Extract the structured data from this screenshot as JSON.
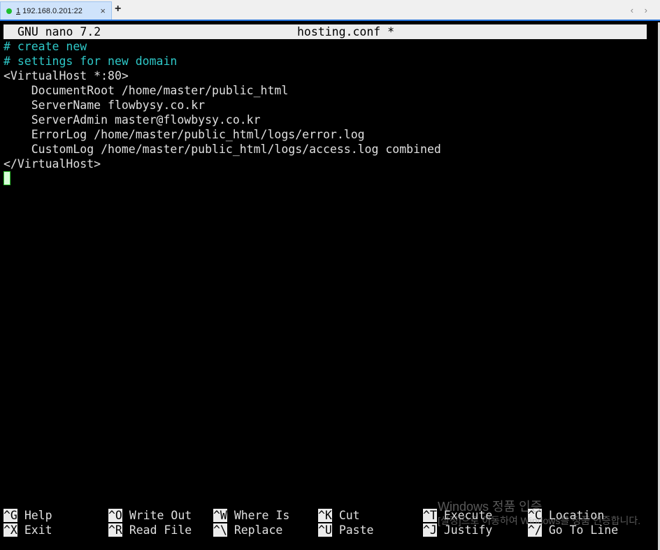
{
  "tab": {
    "number": "1",
    "host": " 192.168.0.201:22",
    "close": "×",
    "new": "+"
  },
  "nav": {
    "arrows": "‹ ›"
  },
  "editor": {
    "app": "GNU nano 7.2",
    "filename": "hosting.conf *",
    "lines": [
      {
        "text": "# create new",
        "comment": true
      },
      {
        "text": "# settings for new domain",
        "comment": true
      },
      {
        "text": "<VirtualHost *:80>",
        "comment": false
      },
      {
        "text": "    DocumentRoot /home/master/public_html",
        "comment": false
      },
      {
        "text": "    ServerName flowbysy.co.kr",
        "comment": false
      },
      {
        "text": "    ServerAdmin master@flowbysy.co.kr",
        "comment": false
      },
      {
        "text": "    ErrorLog /home/master/public_html/logs/error.log",
        "comment": false
      },
      {
        "text": "    CustomLog /home/master/public_html/logs/access.log combined",
        "comment": false
      },
      {
        "text": "</VirtualHost>",
        "comment": false
      }
    ]
  },
  "shortcuts": [
    {
      "key": "^G",
      "label": "Help"
    },
    {
      "key": "^O",
      "label": "Write Out"
    },
    {
      "key": "^W",
      "label": "Where Is"
    },
    {
      "key": "^K",
      "label": "Cut"
    },
    {
      "key": "^T",
      "label": "Execute"
    },
    {
      "key": "^C",
      "label": "Location"
    },
    {
      "key": "^X",
      "label": "Exit"
    },
    {
      "key": "^R",
      "label": "Read File"
    },
    {
      "key": "^\\",
      "label": "Replace"
    },
    {
      "key": "^U",
      "label": "Paste"
    },
    {
      "key": "^J",
      "label": "Justify"
    },
    {
      "key": "^/",
      "label": "Go To Line"
    }
  ],
  "watermark": {
    "line1": "Windows 정품 인증",
    "line2": "[설정]으로 이동하여 Windows를 정품 인증합니다."
  },
  "colors": {
    "comment": "#2ec8c8",
    "tab_active": "#cfe3fb",
    "status_dot": "#1fbf2f"
  }
}
